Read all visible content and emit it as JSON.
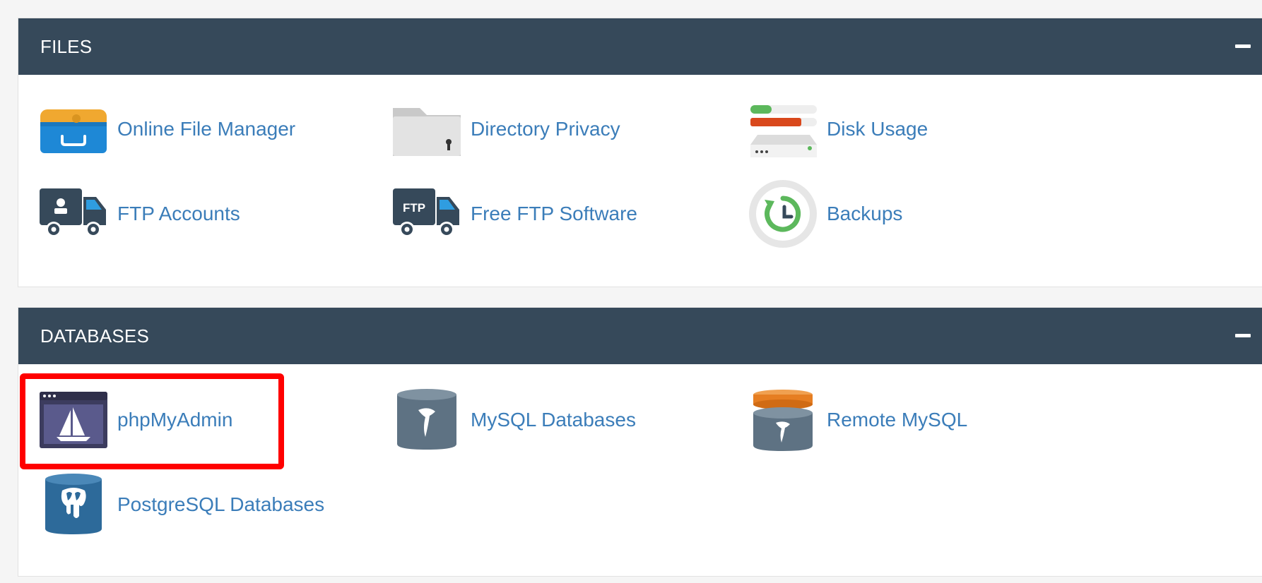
{
  "files": {
    "title": "FILES",
    "items": [
      {
        "label": "Online File Manager",
        "icon": "file-manager-icon"
      },
      {
        "label": "Directory Privacy",
        "icon": "directory-privacy-icon"
      },
      {
        "label": "Disk Usage",
        "icon": "disk-usage-icon"
      },
      {
        "label": "FTP Accounts",
        "icon": "ftp-accounts-icon"
      },
      {
        "label": "Free FTP Software",
        "icon": "ftp-software-icon"
      },
      {
        "label": "Backups",
        "icon": "backups-icon"
      }
    ],
    "ftp_badge": "FTP"
  },
  "databases": {
    "title": "DATABASES",
    "items": [
      {
        "label": "phpMyAdmin",
        "icon": "phpmyadmin-icon"
      },
      {
        "label": "MySQL Databases",
        "icon": "mysql-databases-icon"
      },
      {
        "label": "Remote MySQL",
        "icon": "remote-mysql-icon"
      },
      {
        "label": "PostgreSQL Databases",
        "icon": "postgresql-icon"
      }
    ]
  },
  "colors": {
    "header_bg": "#36495a",
    "link": "#3b7db9",
    "highlight": "#ff0000",
    "accent_orange": "#e67e22",
    "accent_green": "#5cb85c"
  }
}
